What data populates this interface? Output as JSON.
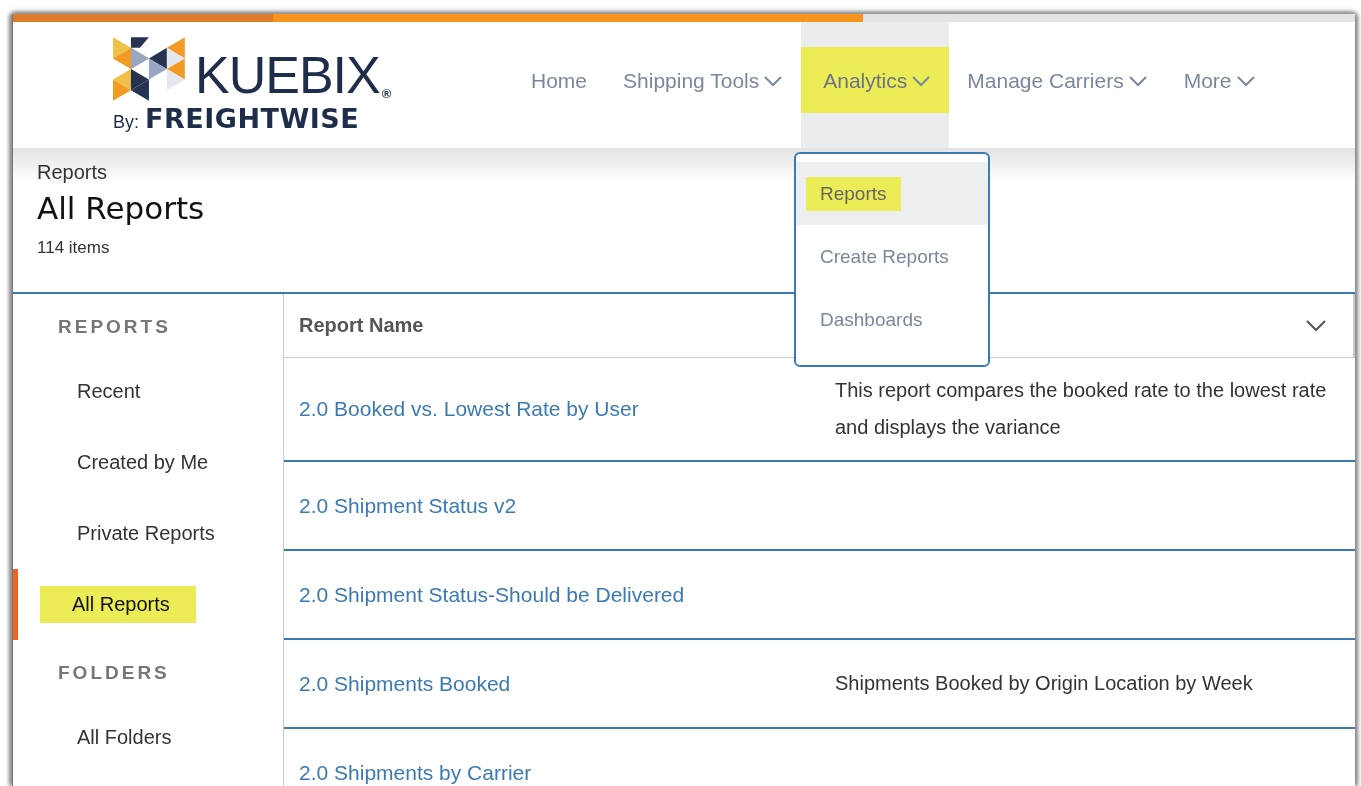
{
  "logo": {
    "name": "KUEBIX",
    "mark": "®",
    "by": "By:",
    "company": "FREIGHTWISE"
  },
  "nav": [
    {
      "label": "Home",
      "dropdown": false,
      "selected": false,
      "highlighted": false
    },
    {
      "label": "Shipping Tools",
      "dropdown": true,
      "selected": false,
      "highlighted": false
    },
    {
      "label": "Analytics",
      "dropdown": true,
      "selected": true,
      "highlighted": true
    },
    {
      "label": "Manage Carriers",
      "dropdown": true,
      "selected": false,
      "highlighted": false
    },
    {
      "label": "More",
      "dropdown": true,
      "selected": false,
      "highlighted": false
    }
  ],
  "menu": [
    {
      "label": "Reports",
      "selected": true,
      "highlighted": true
    },
    {
      "label": "Create Reports",
      "selected": false,
      "highlighted": false
    },
    {
      "label": "Dashboards",
      "selected": false,
      "highlighted": false
    }
  ],
  "page": {
    "breadcrumb": "Reports",
    "title": "All Reports",
    "count": "114 items"
  },
  "sidebar": [
    {
      "heading": "REPORTS",
      "items": [
        {
          "label": "Recent",
          "selected": false,
          "highlighted": false
        },
        {
          "label": "Created by Me",
          "selected": false,
          "highlighted": false
        },
        {
          "label": "Private Reports",
          "selected": false,
          "highlighted": false
        },
        {
          "label": "All Reports",
          "selected": true,
          "highlighted": true
        }
      ]
    },
    {
      "heading": "FOLDERS",
      "items": [
        {
          "label": "All Folders",
          "selected": false,
          "highlighted": false
        }
      ]
    }
  ],
  "table": {
    "columns": [
      "Report Name"
    ],
    "rows": [
      {
        "name": "2.0 Booked vs. Lowest Rate by User",
        "description": "This report compares the booked rate to the lowest rate and displays the variance"
      },
      {
        "name": "2.0 Shipment Status v2"
      },
      {
        "name": "2.0 Shipment Status-Should be Delivered"
      },
      {
        "name": "2.0 Shipments Booked",
        "description": "Shipments Booked by Origin Location by Week"
      },
      {
        "name": "2.0 Shipments by Carrier"
      }
    ]
  }
}
